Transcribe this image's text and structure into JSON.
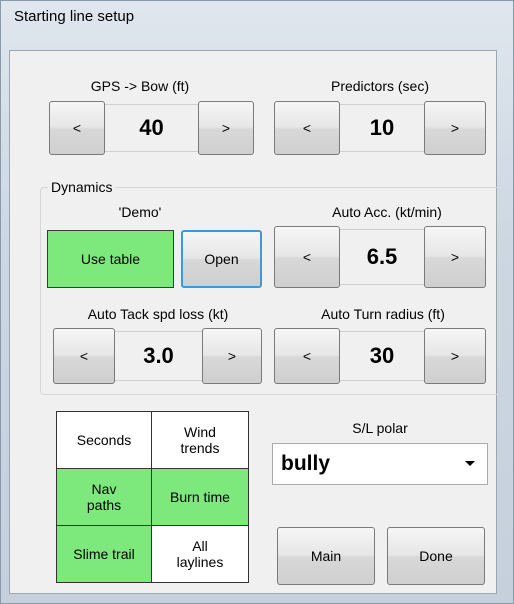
{
  "window": {
    "title": "Starting line setup"
  },
  "gps_bow": {
    "label": "GPS -> Bow (ft)",
    "dec": "<",
    "value": "40",
    "inc": ">"
  },
  "predictors": {
    "label": "Predictors (sec)",
    "dec": "<",
    "value": "10",
    "inc": ">"
  },
  "dynamics": {
    "group_label": "Dynamics",
    "table_name": "'Demo'",
    "use_table": "Use table",
    "open": "Open",
    "auto_acc": {
      "label": "Auto Acc. (kt/min)",
      "dec": "<",
      "value": "6.5",
      "inc": ">"
    },
    "auto_tack": {
      "label": "Auto Tack spd loss (kt)",
      "dec": "<",
      "value": "3.0",
      "inc": ">"
    },
    "auto_turn": {
      "label": "Auto Turn radius (ft)",
      "dec": "<",
      "value": "30",
      "inc": ">"
    }
  },
  "toggles": [
    {
      "label": "Seconds",
      "on": false
    },
    {
      "label": "Wind trends",
      "on": false
    },
    {
      "label": "Nav paths",
      "on": true
    },
    {
      "label": "Burn time",
      "on": true
    },
    {
      "label": "Slime trail",
      "on": true
    },
    {
      "label": "All laylines",
      "on": false
    }
  ],
  "sl_polar": {
    "label": "S/L polar",
    "value": "bully"
  },
  "buttons": {
    "main": "Main",
    "done": "Done"
  },
  "colors": {
    "active_green": "#7de87c",
    "open_focus_border": "#3c9bd6"
  }
}
